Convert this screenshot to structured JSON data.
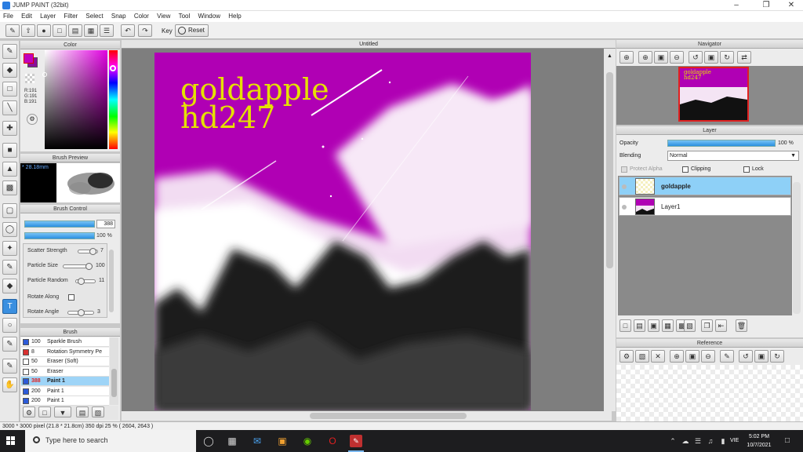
{
  "window": {
    "title": "JUMP PAINT (32bit)"
  },
  "menu": [
    "File",
    "Edit",
    "Layer",
    "Filter",
    "Select",
    "Snap",
    "Color",
    "View",
    "Tool",
    "Window",
    "Help"
  ],
  "toolbar": {
    "key_label": "Key",
    "reset_label": "Reset"
  },
  "color_panel": {
    "title": "Color",
    "r": "R:191",
    "g": "G:191",
    "b": "B:191",
    "main_color": "#bf00bf"
  },
  "brush_preview": {
    "title": "Brush Preview",
    "size": "28.18mm"
  },
  "brush_control": {
    "title": "Brush Control",
    "size_value": "388",
    "opacity_value": "100 %",
    "rows": [
      {
        "label": "Scatter Strength",
        "value": "7"
      },
      {
        "label": "Particle Size",
        "value": "100"
      },
      {
        "label": "Particle Random",
        "value": "11"
      },
      {
        "label": "Rotate Along",
        "value": ""
      },
      {
        "label": "Rotate Angle",
        "value": "3"
      }
    ]
  },
  "brush_list": {
    "title": "Brush",
    "items": [
      {
        "size": "100",
        "name": "Sparkle Brush",
        "color": "#2b5ad8"
      },
      {
        "size": "8",
        "name": "Rotation Symmetry Pe",
        "color": "#d83030"
      },
      {
        "size": "50",
        "name": "Eraser (Soft)",
        "color": "#ffffff"
      },
      {
        "size": "50",
        "name": "Eraser",
        "color": "#ffffff"
      },
      {
        "size": "388",
        "name": "Paint 1",
        "color": "#2b5ad8"
      },
      {
        "size": "200",
        "name": "Paint 1",
        "color": "#2b5ad8"
      },
      {
        "size": "200",
        "name": "Paint 1",
        "color": "#2b5ad8"
      }
    ]
  },
  "document": {
    "tab": "Untitled",
    "art_line1": "goldapple",
    "art_line2": "hd247"
  },
  "navigator": {
    "title": "Navigator",
    "thumb_text1": "goldapple",
    "thumb_text2": "hd247"
  },
  "layer_panel": {
    "title": "Layer",
    "opacity_label": "Opacity",
    "opacity_value": "100 %",
    "blending_label": "Blending",
    "blending_value": "Normal",
    "protect_alpha": "Protect Alpha",
    "clipping": "Clipping",
    "lock": "Lock",
    "layers": [
      {
        "name": "goldapple",
        "selected": true
      },
      {
        "name": "Layer1",
        "selected": false
      }
    ]
  },
  "reference": {
    "title": "Reference"
  },
  "status": {
    "text": "3000 * 3000 pixel   (21.8 * 21.8cm)   350 dpi   25 %   ( 2604, 2643 )"
  },
  "taskbar": {
    "search_placeholder": "Type here to search",
    "lang": "VIE",
    "time": "5:02 PM",
    "date": "10/7/2021"
  }
}
